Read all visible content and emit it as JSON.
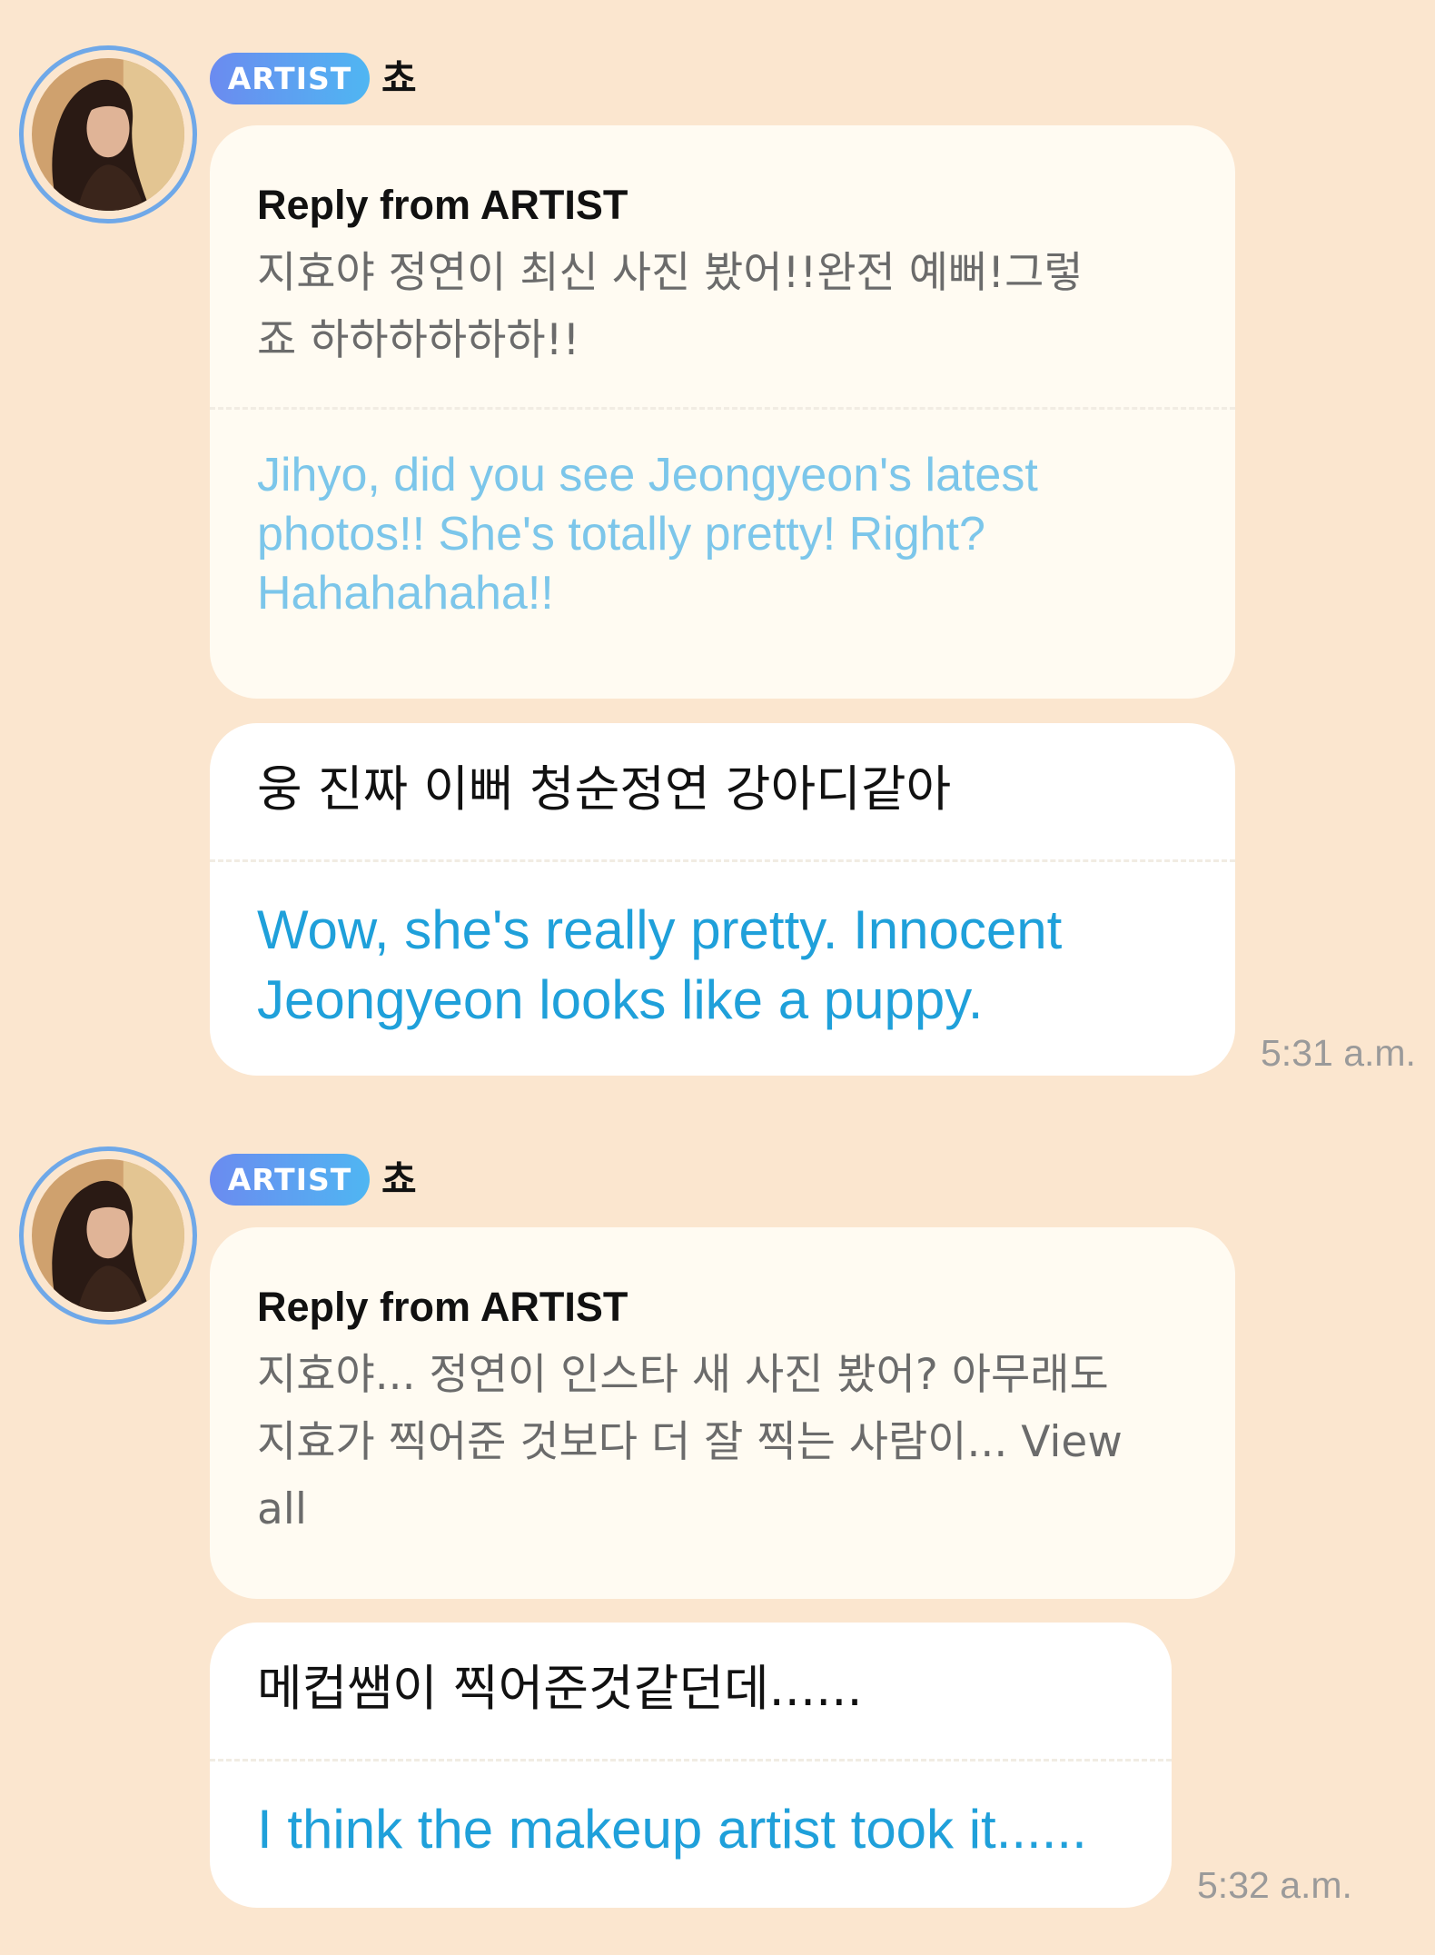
{
  "colors": {
    "background": "#FBE6CF",
    "badge_gradient_start": "#6B8BF0",
    "badge_gradient_end": "#4FB6F2",
    "avatar_ring": "#6FA8E8",
    "reply_bubble": "#FFFBF2",
    "message_bubble": "#FFFFFF",
    "reply_translation": "#7CC6EA",
    "message_translation": "#1FA0DA",
    "timestamp": "#9A9A9A"
  },
  "threads": [
    {
      "author": {
        "badge": "ARTIST",
        "name": "쵸",
        "avatar_icon": "profile-photo"
      },
      "reply": {
        "title": "Reply from ARTIST",
        "original": "지효야 정연이 최신 사진 봤어!!완전 예뻐!그렇\n죠 하하하하하하!!",
        "translation": "Jihyo, did you see Jeongyeon's latest\nphotos!! She's totally pretty! Right?\nHahahahaha!!"
      },
      "message": {
        "original": "웅 진짜 이뻐 청순정연 강아디같아",
        "translation": "Wow, she's really pretty. Innocent\nJeongyeon looks like a puppy.",
        "time": "5:31 a.m."
      }
    },
    {
      "author": {
        "badge": "ARTIST",
        "name": "쵸",
        "avatar_icon": "profile-photo"
      },
      "reply": {
        "title": "Reply from ARTIST",
        "original": "지효야... 정연이 인스타 새 사진 봤어? 아무래도\n지효가 찍어준 것보다 더 잘 찍는 사람이...",
        "view_all": "View all",
        "translation": ""
      },
      "message": {
        "original": "메컵쌤이 찍어준것같던데......",
        "translation": "I think the makeup artist took it......",
        "time": "5:32 a.m."
      }
    }
  ]
}
